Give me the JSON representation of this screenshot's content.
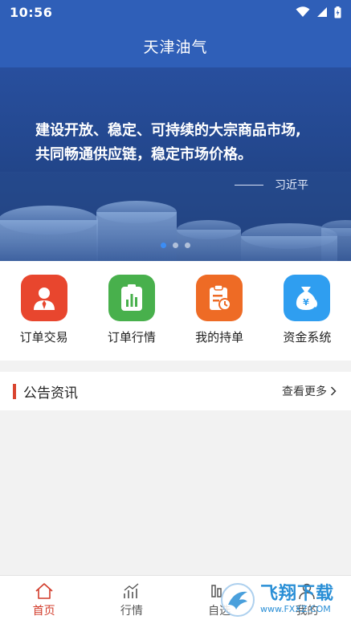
{
  "status_bar": {
    "time": "10:56"
  },
  "header": {
    "title": "天津油气"
  },
  "banner": {
    "quote": "建设开放、稳定、可持续的大宗商品市场,\n共同畅通供应链，稳定市场价格。",
    "author": "习近平",
    "active_index": 0,
    "slide_count": 3
  },
  "quick_menu": {
    "items": [
      {
        "label": "订单交易",
        "icon": "person-icon",
        "color": "#e8462e"
      },
      {
        "label": "订单行情",
        "icon": "bar-chart-icon",
        "color": "#48b04c"
      },
      {
        "label": "我的持单",
        "icon": "clipboard-icon",
        "color": "#ee6b25"
      },
      {
        "label": "资金系统",
        "icon": "money-bag-icon",
        "color": "#2f9ef0"
      }
    ]
  },
  "notice": {
    "title": "公告资讯",
    "more": "查看更多"
  },
  "tab_bar": {
    "tabs": [
      {
        "label": "首页",
        "icon": "home-icon"
      },
      {
        "label": "行情",
        "icon": "market-chart-icon"
      },
      {
        "label": "自选",
        "icon": "favorites-icon"
      },
      {
        "label": "我的",
        "icon": "profile-icon"
      }
    ],
    "active_index": 0
  },
  "watermark": {
    "title": "飞翔下载",
    "url": "www.FXXZ.COM"
  },
  "colors": {
    "primary": "#2f5fb8",
    "accent": "#d23c2b"
  }
}
